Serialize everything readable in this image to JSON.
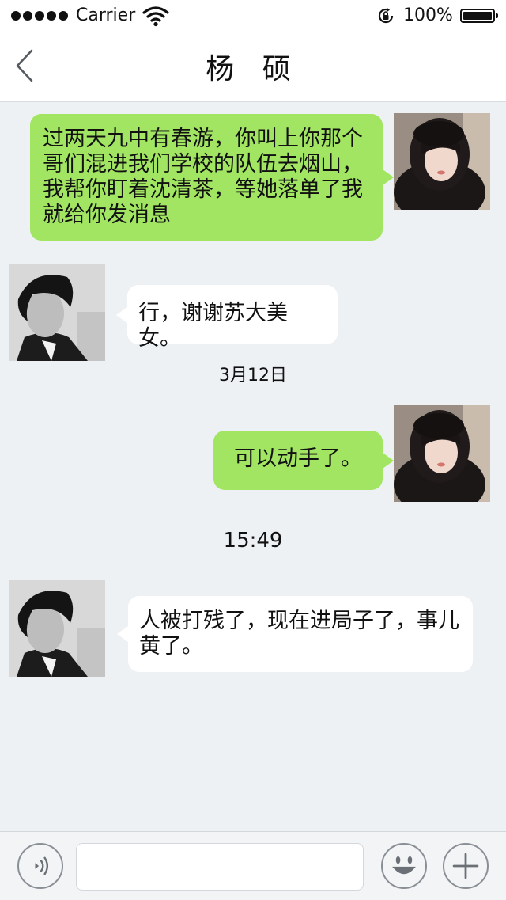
{
  "status_bar": {
    "carrier": "Carrier",
    "battery": "100%",
    "icons": [
      "signal-dots-icon",
      "wifi-icon",
      "rotation-lock-icon",
      "battery-icon"
    ]
  },
  "header": {
    "title": "杨 硕",
    "back_icon": "chevron-left-icon"
  },
  "messages": [
    {
      "sender": "self",
      "text": "过两天九中有春游，你叫上你那个哥们混进我们学校的队伍去烟山，我帮你盯着沈清茶，等她落单了我就给你发消息"
    },
    {
      "sender": "contact",
      "text": "行，谢谢苏大美女。"
    },
    {
      "type": "timestamp",
      "text": "3月12日"
    },
    {
      "sender": "self",
      "text": "可以动手了。"
    },
    {
      "type": "timestamp",
      "text": "15:49"
    },
    {
      "sender": "contact",
      "text": "人被打残了，现在进局子了，事儿黄了。"
    }
  ],
  "input_bar": {
    "text_value": "",
    "icons": [
      "voice-icon",
      "emoji-icon",
      "plus-icon"
    ]
  },
  "colors": {
    "outgoing_bubble": "#a2e563",
    "incoming_bubble": "#ffffff",
    "chat_background": "#eef1f4"
  }
}
